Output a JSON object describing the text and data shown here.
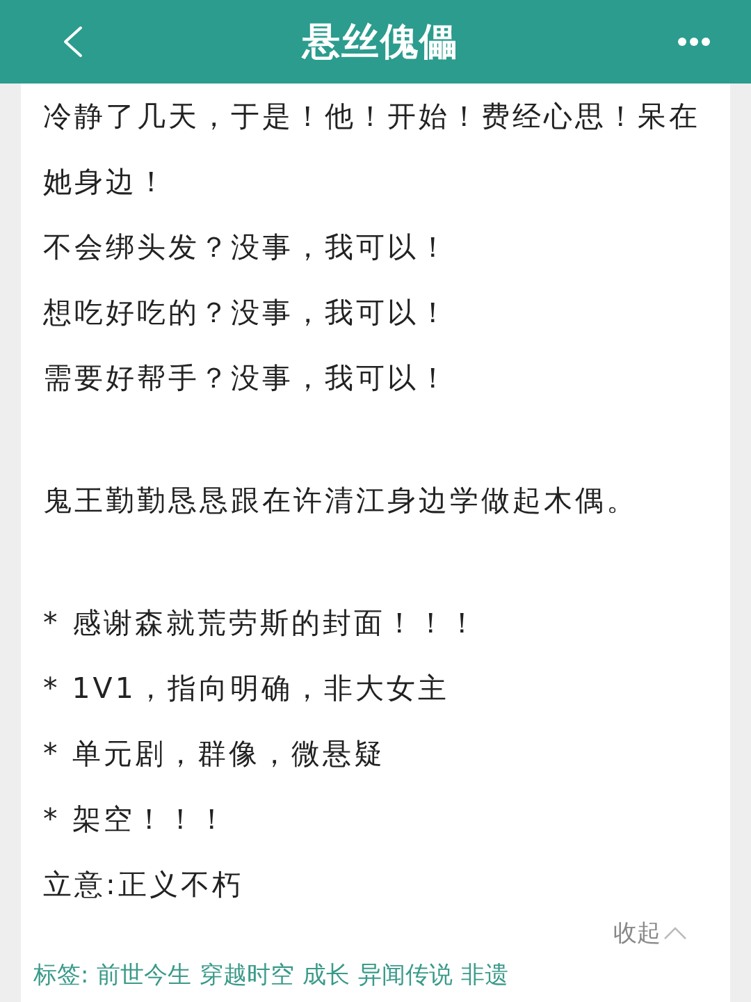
{
  "header": {
    "title": "悬丝傀儡"
  },
  "blocks": [
    {
      "lines": [
        "冷静了几天，于是！他！开始！费经心思！呆在她身边！",
        "不会绑头发？没事，我可以！",
        "想吃好吃的？没事，我可以！",
        "需要好帮手？没事，我可以！"
      ]
    },
    {
      "lines": [
        "鬼王勤勤恳恳跟在许清江身边学做起木偶。"
      ]
    },
    {
      "lines": [
        "* 感谢森就荒劳斯的封面！！！",
        "* 1V1，指向明确，非大女主",
        "* 单元剧，群像，微悬疑",
        "* 架空！！！",
        "立意:正义不朽"
      ]
    }
  ],
  "collapse": {
    "label": "收起"
  },
  "tags": {
    "label": "标签:",
    "items": [
      "前世今生",
      "穿越时空",
      "成长",
      "异闻传说",
      "非遗"
    ]
  }
}
